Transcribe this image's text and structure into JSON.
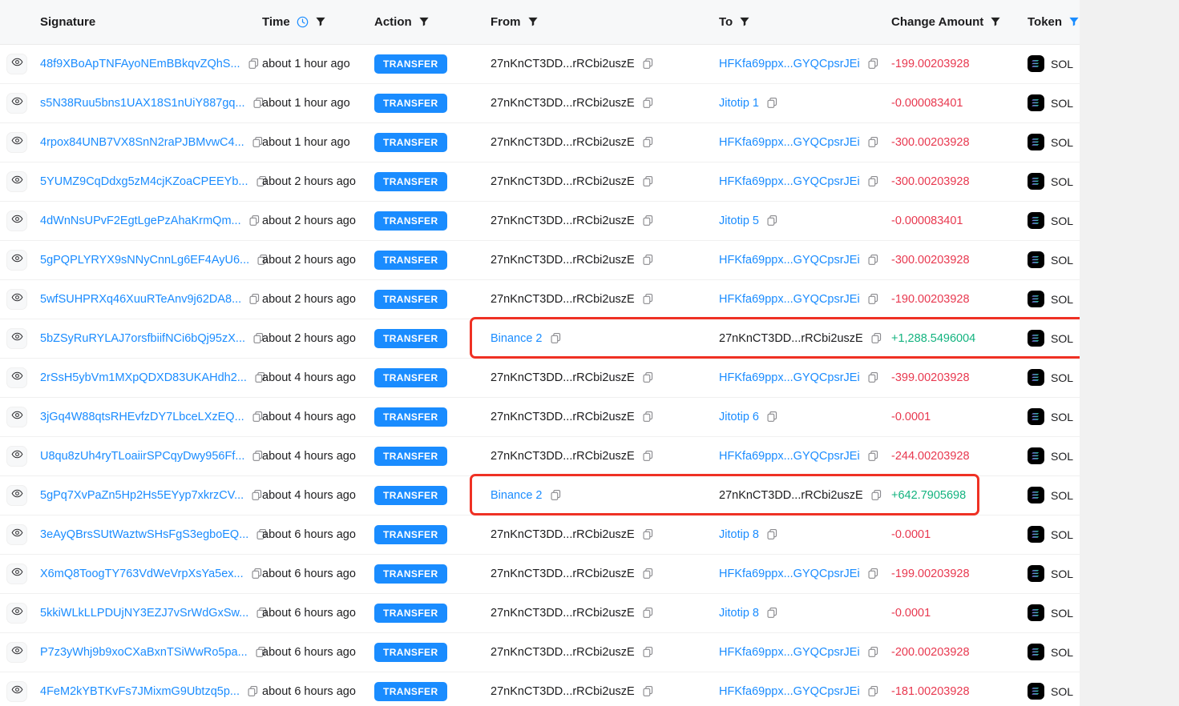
{
  "table": {
    "columns": [
      {
        "key": "eye",
        "label": "",
        "icons": []
      },
      {
        "key": "sig",
        "label": "Signature",
        "icons": []
      },
      {
        "key": "time",
        "label": "Time",
        "icons": [
          "clock-icon",
          "filter-icon"
        ]
      },
      {
        "key": "action",
        "label": "Action",
        "icons": [
          "filter-icon"
        ]
      },
      {
        "key": "from",
        "label": "From",
        "icons": [
          "filter-icon"
        ]
      },
      {
        "key": "to",
        "label": "To",
        "icons": [
          "filter-icon"
        ]
      },
      {
        "key": "amount",
        "label": "Change Amount",
        "icons": [
          "filter-icon"
        ]
      },
      {
        "key": "token",
        "label": "Token",
        "icons": [
          "filter-icon-active"
        ]
      }
    ],
    "rows": [
      {
        "signature": "48f9XBoApTNFAyoNEmBBkqvZQhS...",
        "time": "about 1 hour ago",
        "action": "TRANSFER",
        "from": "27nKnCT3DD...rRCbi2uszE",
        "from_link": false,
        "to": "HFKfa69ppx...GYQCpsrJEi",
        "to_link": true,
        "amount": "-199.00203928",
        "amount_sign": "neg",
        "token": "SOL",
        "highlight": false
      },
      {
        "signature": "s5N38Ruu5bns1UAX18S1nUiY887gq...",
        "time": "about 1 hour ago",
        "action": "TRANSFER",
        "from": "27nKnCT3DD...rRCbi2uszE",
        "from_link": false,
        "to": "Jitotip 1",
        "to_link": true,
        "amount": "-0.000083401",
        "amount_sign": "neg",
        "token": "SOL",
        "highlight": false
      },
      {
        "signature": "4rpox84UNB7VX8SnN2raPJBMvwC4...",
        "time": "about 1 hour ago",
        "action": "TRANSFER",
        "from": "27nKnCT3DD...rRCbi2uszE",
        "from_link": false,
        "to": "HFKfa69ppx...GYQCpsrJEi",
        "to_link": true,
        "amount": "-300.00203928",
        "amount_sign": "neg",
        "token": "SOL",
        "highlight": false
      },
      {
        "signature": "5YUMZ9CqDdxg5zM4cjKZoaCPEEYb...",
        "time": "about 2 hours ago",
        "action": "TRANSFER",
        "from": "27nKnCT3DD...rRCbi2uszE",
        "from_link": false,
        "to": "HFKfa69ppx...GYQCpsrJEi",
        "to_link": true,
        "amount": "-300.00203928",
        "amount_sign": "neg",
        "token": "SOL",
        "highlight": false
      },
      {
        "signature": "4dWnNsUPvF2EgtLgePzAhaKrmQm...",
        "time": "about 2 hours ago",
        "action": "TRANSFER",
        "from": "27nKnCT3DD...rRCbi2uszE",
        "from_link": false,
        "to": "Jitotip 5",
        "to_link": true,
        "amount": "-0.000083401",
        "amount_sign": "neg",
        "token": "SOL",
        "highlight": false
      },
      {
        "signature": "5gPQPLYRYX9sNNyCnnLg6EF4AyU6...",
        "time": "about 2 hours ago",
        "action": "TRANSFER",
        "from": "27nKnCT3DD...rRCbi2uszE",
        "from_link": false,
        "to": "HFKfa69ppx...GYQCpsrJEi",
        "to_link": true,
        "amount": "-300.00203928",
        "amount_sign": "neg",
        "token": "SOL",
        "highlight": false
      },
      {
        "signature": "5wfSUHPRXq46XuuRTeAnv9j62DA8...",
        "time": "about 2 hours ago",
        "action": "TRANSFER",
        "from": "27nKnCT3DD...rRCbi2uszE",
        "from_link": false,
        "to": "HFKfa69ppx...GYQCpsrJEi",
        "to_link": true,
        "amount": "-190.00203928",
        "amount_sign": "neg",
        "token": "SOL",
        "highlight": false
      },
      {
        "signature": "5bZSyRuRYLAJ7orsfbiifNCi6bQj95zX...",
        "time": "about 2 hours ago",
        "action": "TRANSFER",
        "from": "Binance 2",
        "from_link": true,
        "to": "27nKnCT3DD...rRCbi2uszE",
        "to_link": false,
        "amount": "+1,288.5496004",
        "amount_sign": "pos",
        "token": "SOL",
        "highlight": true
      },
      {
        "signature": "2rSsH5ybVm1MXpQDXD83UKAHdh2...",
        "time": "about 4 hours ago",
        "action": "TRANSFER",
        "from": "27nKnCT3DD...rRCbi2uszE",
        "from_link": false,
        "to": "HFKfa69ppx...GYQCpsrJEi",
        "to_link": true,
        "amount": "-399.00203928",
        "amount_sign": "neg",
        "token": "SOL",
        "highlight": false
      },
      {
        "signature": "3jGq4W88qtsRHEvfzDY7LbceLXzEQ...",
        "time": "about 4 hours ago",
        "action": "TRANSFER",
        "from": "27nKnCT3DD...rRCbi2uszE",
        "from_link": false,
        "to": "Jitotip 6",
        "to_link": true,
        "amount": "-0.0001",
        "amount_sign": "neg",
        "token": "SOL",
        "highlight": false
      },
      {
        "signature": "U8qu8zUh4ryTLoaiirSPCqyDwy956Ff...",
        "time": "about 4 hours ago",
        "action": "TRANSFER",
        "from": "27nKnCT3DD...rRCbi2uszE",
        "from_link": false,
        "to": "HFKfa69ppx...GYQCpsrJEi",
        "to_link": true,
        "amount": "-244.00203928",
        "amount_sign": "neg",
        "token": "SOL",
        "highlight": false
      },
      {
        "signature": "5gPq7XvPaZn5Hp2Hs5EYyp7xkrzCV...",
        "time": "about 4 hours ago",
        "action": "TRANSFER",
        "from": "Binance 2",
        "from_link": true,
        "to": "27nKnCT3DD...rRCbi2uszE",
        "to_link": false,
        "amount": "+642.7905698",
        "amount_sign": "pos",
        "token": "SOL",
        "highlight": true
      },
      {
        "signature": "3eAyQBrsSUtWaztwSHsFgS3egboEQ...",
        "time": "about 6 hours ago",
        "action": "TRANSFER",
        "from": "27nKnCT3DD...rRCbi2uszE",
        "from_link": false,
        "to": "Jitotip 8",
        "to_link": true,
        "amount": "-0.0001",
        "amount_sign": "neg",
        "token": "SOL",
        "highlight": false
      },
      {
        "signature": "X6mQ8ToogTY763VdWeVrpXsYa5ex...",
        "time": "about 6 hours ago",
        "action": "TRANSFER",
        "from": "27nKnCT3DD...rRCbi2uszE",
        "from_link": false,
        "to": "HFKfa69ppx...GYQCpsrJEi",
        "to_link": true,
        "amount": "-199.00203928",
        "amount_sign": "neg",
        "token": "SOL",
        "highlight": false
      },
      {
        "signature": "5kkiWLkLLPDUjNY3EZJ7vSrWdGxSw...",
        "time": "about 6 hours ago",
        "action": "TRANSFER",
        "from": "27nKnCT3DD...rRCbi2uszE",
        "from_link": false,
        "to": "Jitotip 8",
        "to_link": true,
        "amount": "-0.0001",
        "amount_sign": "neg",
        "token": "SOL",
        "highlight": false
      },
      {
        "signature": "P7z3yWhj9b9xoCXaBxnTSiWwRo5pa...",
        "time": "about 6 hours ago",
        "action": "TRANSFER",
        "from": "27nKnCT3DD...rRCbi2uszE",
        "from_link": false,
        "to": "HFKfa69ppx...GYQCpsrJEi",
        "to_link": true,
        "amount": "-200.00203928",
        "amount_sign": "neg",
        "token": "SOL",
        "highlight": false
      },
      {
        "signature": "4FeM2kYBTKvFs7JMixmG9Ubtzq5p...",
        "time": "about 6 hours ago",
        "action": "TRANSFER",
        "from": "27nKnCT3DD...rRCbi2uszE",
        "from_link": false,
        "to": "HFKfa69ppx...GYQCpsrJEi",
        "to_link": true,
        "amount": "-181.00203928",
        "amount_sign": "neg",
        "token": "SOL",
        "highlight": false
      }
    ]
  },
  "colors": {
    "link": "#1a8cff",
    "badge": "#1a8cff",
    "negative": "#e8384f",
    "positive": "#13b37f",
    "highlight": "#ef3124",
    "header_bg": "#f7f8f9",
    "page_bg": "#f1f1f1"
  }
}
